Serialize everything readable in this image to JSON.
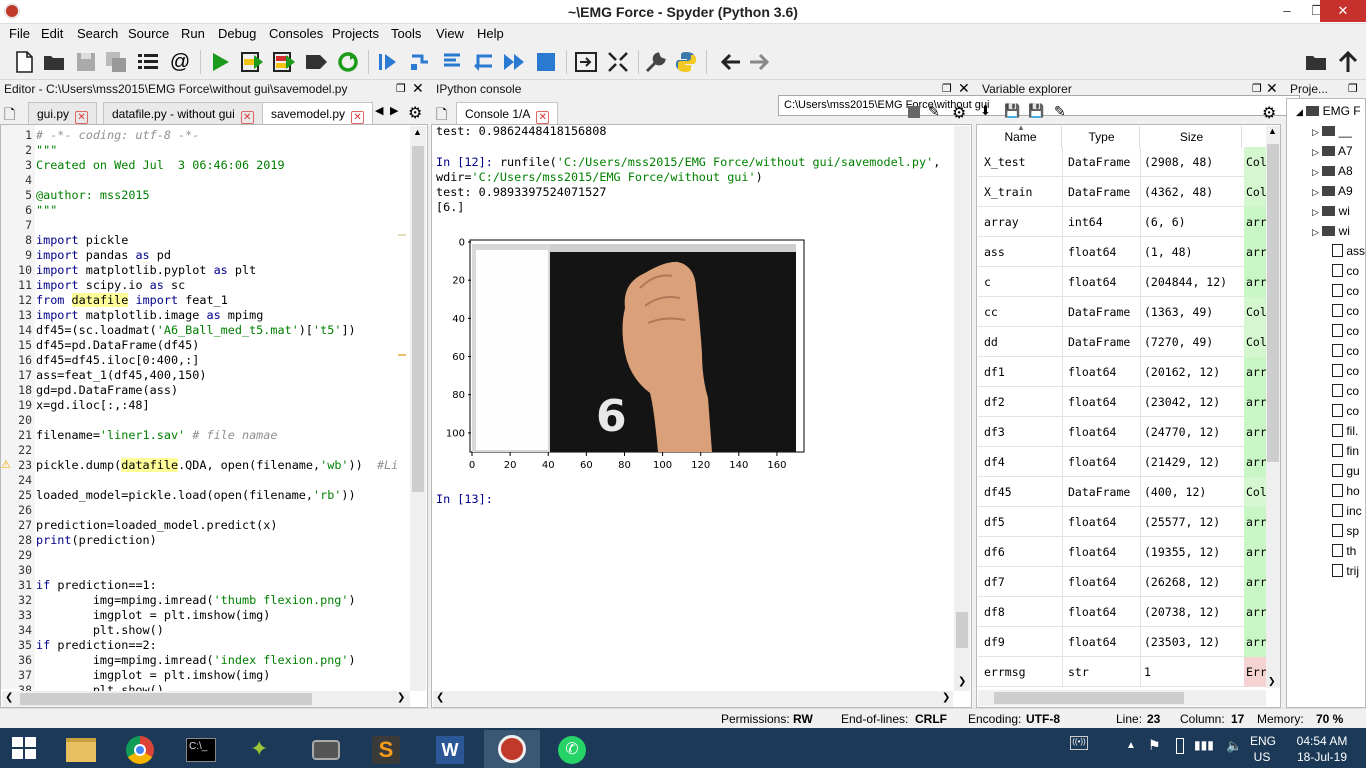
{
  "window": {
    "title": "~\\EMG Force - Spyder (Python 3.6)"
  },
  "menu": [
    "File",
    "Edit",
    "Search",
    "Source",
    "Run",
    "Debug",
    "Consoles",
    "Projects",
    "Tools",
    "View",
    "Help"
  ],
  "toolbar": {
    "path": "C:\\Users\\mss2015\\EMG Force\\without gui"
  },
  "editor": {
    "title": "Editor - C:\\Users\\mss2015\\EMG Force\\without gui\\savemodel.py",
    "tabs": [
      {
        "label": "gui.py"
      },
      {
        "label": "datafile.py - without gui"
      },
      {
        "label": "savemodel.py"
      }
    ],
    "line_numbers": [
      "1",
      "2",
      "3",
      "4",
      "5",
      "6",
      "7",
      "8",
      "9",
      "10",
      "11",
      "12",
      "13",
      "14",
      "15",
      "16",
      "17",
      "18",
      "19",
      "20",
      "21",
      "22",
      "23",
      "24",
      "25",
      "26",
      "27",
      "28",
      "29",
      "30",
      "31",
      "32",
      "33",
      "34",
      "35",
      "36",
      "37",
      "38"
    ]
  },
  "console": {
    "title": "IPython console",
    "tab": "Console 1/A",
    "lines": {
      "l1": "test: 0.9862448418156808",
      "l2_prompt": "In [12]:",
      "l2_cmd": "runfile(",
      "l2_arg": "'C:/Users/mss2015/EMG Force/without gui/savemodel.py'",
      "l2_end": ",",
      "l3_pre": "wdir=",
      "l3_arg": "'C:/Users/mss2015/EMG Force/without gui'",
      "l3_end": ")",
      "l4": "test: 0.9893397524071527",
      "l5": "[6.]",
      "l6": "In [13]:"
    },
    "plot": {
      "y_ticks": [
        "0",
        "20",
        "40",
        "60",
        "80",
        "100"
      ],
      "x_ticks": [
        "0",
        "20",
        "40",
        "60",
        "80",
        "100",
        "120",
        "140",
        "160"
      ],
      "digit": "6"
    }
  },
  "variable_explorer": {
    "title": "Variable explorer",
    "headers": [
      "Name",
      "Type",
      "Size"
    ],
    "rows": [
      {
        "name": "X_test",
        "type": "DataFrame",
        "size": "(2908, 48)",
        "value": "Col"
      },
      {
        "name": "X_train",
        "type": "DataFrame",
        "size": "(4362, 48)",
        "value": "Col"
      },
      {
        "name": "array",
        "type": "int64",
        "size": "(6, 6)",
        "value": "arr"
      },
      {
        "name": "ass",
        "type": "float64",
        "size": "(1, 48)",
        "value": "arr"
      },
      {
        "name": "c",
        "type": "float64",
        "size": "(204844, 12)",
        "value": "arr"
      },
      {
        "name": "cc",
        "type": "DataFrame",
        "size": "(1363, 49)",
        "value": "Col"
      },
      {
        "name": "dd",
        "type": "DataFrame",
        "size": "(7270, 49)",
        "value": "Col"
      },
      {
        "name": "df1",
        "type": "float64",
        "size": "(20162, 12)",
        "value": "arr"
      },
      {
        "name": "df2",
        "type": "float64",
        "size": "(23042, 12)",
        "value": "arr"
      },
      {
        "name": "df3",
        "type": "float64",
        "size": "(24770, 12)",
        "value": "arr"
      },
      {
        "name": "df4",
        "type": "float64",
        "size": "(21429, 12)",
        "value": "arr"
      },
      {
        "name": "df45",
        "type": "DataFrame",
        "size": "(400, 12)",
        "value": "Col"
      },
      {
        "name": "df5",
        "type": "float64",
        "size": "(25577, 12)",
        "value": "arr"
      },
      {
        "name": "df6",
        "type": "float64",
        "size": "(19355, 12)",
        "value": "arr"
      },
      {
        "name": "df7",
        "type": "float64",
        "size": "(26268, 12)",
        "value": "arr"
      },
      {
        "name": "df8",
        "type": "float64",
        "size": "(20738, 12)",
        "value": "arr"
      },
      {
        "name": "df9",
        "type": "float64",
        "size": "(23503, 12)",
        "value": "arr"
      },
      {
        "name": "errmsg",
        "type": "str",
        "size": "1",
        "value": "Err"
      }
    ]
  },
  "project": {
    "title": "Proje...",
    "root": "EMG F",
    "folders": [
      "__",
      "A7",
      "A8",
      "A9",
      "wi",
      "wi"
    ],
    "files": [
      "ass",
      "co",
      "co",
      "co",
      "co",
      "co",
      "co",
      "co",
      "co",
      "fil.",
      "fin",
      "gu",
      "ho",
      "inc",
      "sp",
      "th",
      "trij"
    ]
  },
  "status": {
    "permissions_label": "Permissions:",
    "permissions": "RW",
    "eol_label": "End-of-lines:",
    "eol": "CRLF",
    "encoding_label": "Encoding:",
    "encoding": "UTF-8",
    "line_label": "Line:",
    "line": "23",
    "column_label": "Column:",
    "column": "17",
    "memory_label": "Memory:",
    "memory": "70 %"
  },
  "taskbar": {
    "lang1": "ENG",
    "lang2": "US",
    "time": "04:54 AM",
    "date": "18-Jul-19"
  }
}
